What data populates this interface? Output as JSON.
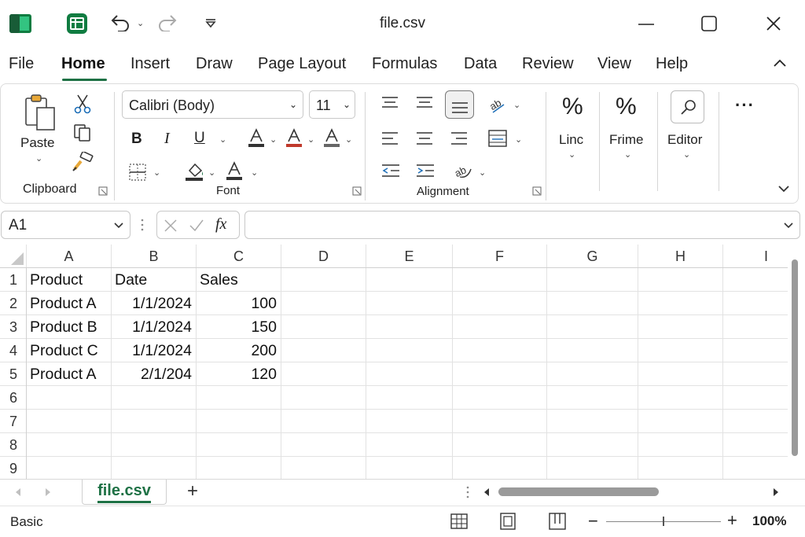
{
  "window": {
    "title": "file.csv"
  },
  "menu": {
    "items": [
      "File",
      "Home",
      "Insert",
      "Draw",
      "Page Layout",
      "Formulas",
      "Data",
      "Review",
      "View",
      "Help"
    ],
    "active": "Home"
  },
  "ribbon": {
    "clipboard": {
      "paste_label": "Paste",
      "group_label": "Clipboard"
    },
    "font": {
      "name": "Calibri (Body)",
      "size": "11",
      "bold": "B",
      "italic": "I",
      "underline": "U",
      "group_label": "Font"
    },
    "alignment": {
      "group_label": "Alignment"
    },
    "number": {
      "label": "Linc"
    },
    "styles": {
      "label": "Frime"
    },
    "editing": {
      "label": "Editor"
    },
    "more": "···"
  },
  "formula_bar": {
    "name_box": "A1",
    "fx": "fx",
    "value": ""
  },
  "grid": {
    "columns": [
      "A",
      "B",
      "C",
      "D",
      "E",
      "F",
      "G",
      "H",
      "I"
    ],
    "rows": [
      "1",
      "2",
      "3",
      "4",
      "5",
      "6",
      "7",
      "8",
      "9"
    ],
    "cells": [
      [
        "Product",
        "Date",
        "Sales"
      ],
      [
        "Product A",
        "1/1/2024",
        "100"
      ],
      [
        "Product B",
        "1/1/2024",
        "150"
      ],
      [
        "Product C",
        "1/1/2024",
        "200"
      ],
      [
        "Product A",
        "2/1/204",
        "120"
      ]
    ]
  },
  "sheets": {
    "active": "file.csv",
    "add": "+"
  },
  "status": {
    "mode": "Basic",
    "zoom_out": "−",
    "zoom_in": "+",
    "zoom": "100%"
  },
  "colors": {
    "accent": "#1e7145",
    "excel_green": "#107c41",
    "font_color_red": "#c0392b"
  }
}
